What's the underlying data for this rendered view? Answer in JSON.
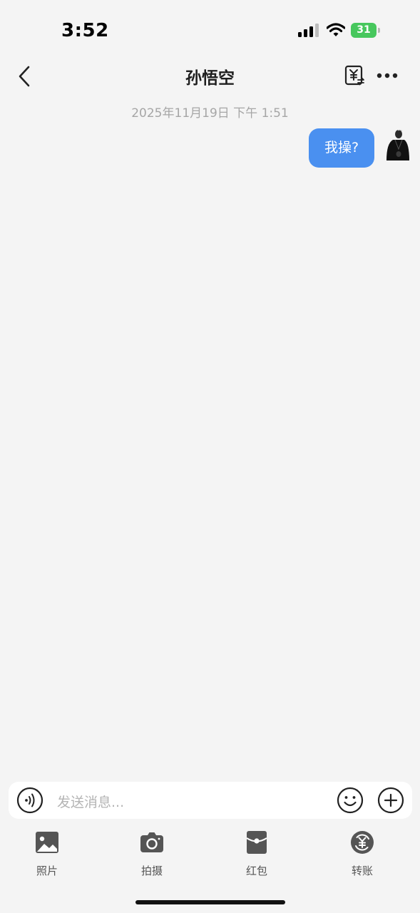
{
  "status_bar": {
    "time": "3:52",
    "battery": "31"
  },
  "nav": {
    "title": "孙悟空"
  },
  "chat": {
    "timestamp": "2025年11月19日 下午 1:51",
    "messages": [
      {
        "sender": "self",
        "text": "我操?"
      }
    ]
  },
  "input": {
    "placeholder": "发送消息..."
  },
  "toolbar": {
    "photo": "照片",
    "camera": "拍摄",
    "red_packet": "红包",
    "transfer": "转账"
  },
  "colors": {
    "bubble": "#4a90f0",
    "battery": "#47c75d",
    "background": "#f4f4f4"
  }
}
